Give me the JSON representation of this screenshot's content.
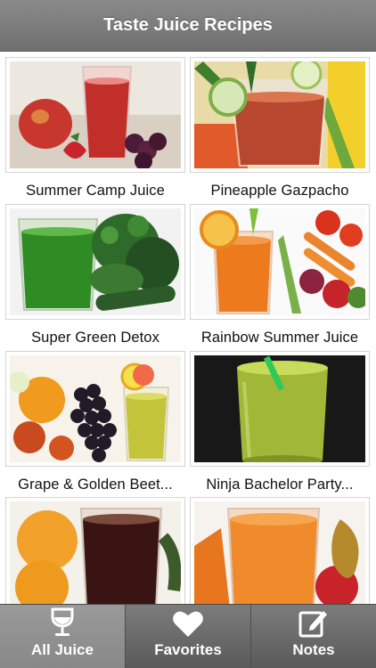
{
  "header": {
    "title": "Taste Juice Recipes"
  },
  "recipes": [
    {
      "name": "Summer Camp Juice"
    },
    {
      "name": "Pineapple Gazpacho"
    },
    {
      "name": "Super Green Detox"
    },
    {
      "name": "Rainbow Summer Juice"
    },
    {
      "name": "Grape & Golden Beet..."
    },
    {
      "name": "Ninja Bachelor Party..."
    },
    {
      "name": ""
    },
    {
      "name": ""
    }
  ],
  "tabs": [
    {
      "label": "All Juice",
      "icon": "wine-glass-icon",
      "active": true
    },
    {
      "label": "Favorites",
      "icon": "heart-icon",
      "active": false
    },
    {
      "label": "Notes",
      "icon": "note-edit-icon",
      "active": false
    }
  ],
  "colors": {
    "navbar": "#7d7d7d",
    "tabbar": "#6a6a6a",
    "active_tab": "#8f8f8f"
  }
}
